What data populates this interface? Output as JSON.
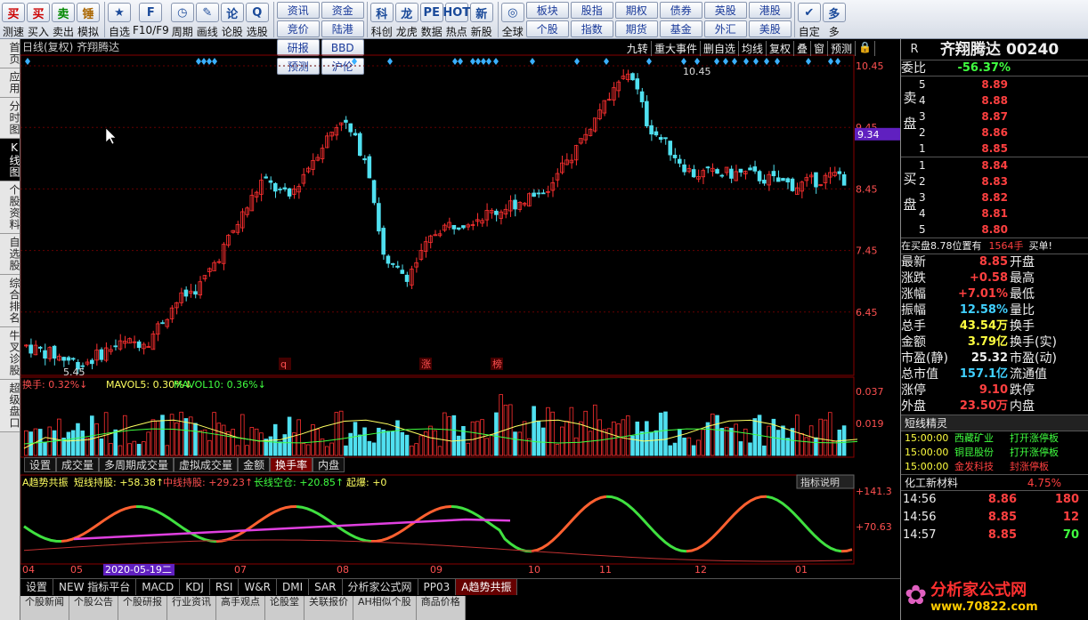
{
  "toolbar": {
    "buttons": [
      {
        "icon": "买",
        "label": "测速",
        "color": "#c00"
      },
      {
        "icon": "买",
        "label": "买入",
        "color": "#c00"
      },
      {
        "icon": "卖",
        "label": "卖出",
        "color": "#080"
      },
      {
        "icon": "锤",
        "label": "模拟",
        "color": "#a60"
      }
    ],
    "buttons2": [
      {
        "icon": "★",
        "label": "自选"
      },
      {
        "icon": "F",
        "label": "F10/F9"
      },
      {
        "icon": "◷",
        "label": "周期"
      },
      {
        "icon": "✎",
        "label": "画线"
      },
      {
        "icon": "论",
        "label": "论股"
      },
      {
        "icon": "Q",
        "label": "选股"
      }
    ],
    "grid1": [
      "资讯",
      "资金",
      "竞价",
      "陆港",
      "研报",
      "BBD",
      "预测",
      "沪伦"
    ],
    "buttons3": [
      {
        "icon": "科",
        "label": "科创"
      },
      {
        "icon": "龙",
        "label": "龙虎"
      },
      {
        "icon": "PE",
        "label": "数据"
      },
      {
        "icon": "HOT",
        "label": "热点"
      },
      {
        "icon": "新",
        "label": "新股"
      }
    ],
    "buttons4": [
      {
        "icon": "◎",
        "label": "全球"
      }
    ],
    "grid2": [
      "板块",
      "股指",
      "期权",
      "债券",
      "英股",
      "港股",
      "个股",
      "指数",
      "期货",
      "基金",
      "外汇",
      "美股"
    ],
    "buttons5": [
      {
        "icon": "✔",
        "label": "自定"
      },
      {
        "icon": "多",
        "label": "多"
      }
    ]
  },
  "leftnav": [
    "首页",
    "应用",
    "分时图",
    "K线图",
    "个股资料",
    "自选股",
    "综合排名",
    "牛叉诊股",
    "超级盘口"
  ],
  "chart": {
    "title": "日线(复权) 齐翔腾达",
    "top_buttons": [
      "九转",
      "重大事件",
      "删自选",
      "均线",
      "复权",
      "叠",
      "窗",
      "预测",
      "🔒"
    ],
    "price_labels": [
      "10.45",
      "9.45",
      "8.45",
      "7.45",
      "6.45"
    ],
    "current_price": "9.34",
    "high_annot": "10.45",
    "low_annot": "5.45",
    "markers": [
      "q",
      "涨",
      "榜"
    ],
    "vol_header": {
      "a": "换手: 0.32%↓",
      "b": "MAVOL5: 0.30%↓",
      "c": "MAVOL10: 0.36%↓"
    },
    "vol_labels": [
      "0.037",
      "0.019"
    ],
    "sub_tabs": [
      "设置",
      "成交量",
      "多周期成交量",
      "虚拟成交量",
      "金额",
      "换手率",
      "内盘"
    ],
    "ind_header": {
      "name": "A趋势共振",
      "a": "短线持股: +58.38↑",
      "b": "中线持股: +29.23↑",
      "c": "长线空仓: +20.85↑",
      "d": "起爆: +0"
    },
    "ind_button": "指标说明",
    "ind_labels": [
      "+141.3",
      "+70.63"
    ],
    "months": [
      "04",
      "05",
      "2020-05-19二",
      "07",
      "08",
      "09",
      "10",
      "11",
      "12",
      "01"
    ],
    "bottom_tabs": [
      "设置",
      "NEW 指标平台",
      "MACD",
      "KDJ",
      "RSI",
      "W&R",
      "DMI",
      "SAR",
      "分析家公式网",
      "PP03",
      "A趋势共振"
    ],
    "news_tabs": [
      "个股新闻",
      "个股公告",
      "个股研报",
      "行业资讯",
      "高手观点",
      "论股堂",
      "关联报价",
      "AH相似个股",
      "商品价格"
    ]
  },
  "quote": {
    "r": "R",
    "name": "齐翔腾达",
    "code": "00240",
    "weibi_label": "委比",
    "weibi": "-56.37%",
    "sell_label": "卖盘",
    "buy_label": "买盘",
    "sell": [
      {
        "n": "5",
        "p": "8.89"
      },
      {
        "n": "4",
        "p": "8.88"
      },
      {
        "n": "3",
        "p": "8.87"
      },
      {
        "n": "2",
        "p": "8.86"
      },
      {
        "n": "1",
        "p": "8.85"
      }
    ],
    "buy": [
      {
        "n": "1",
        "p": "8.84"
      },
      {
        "n": "2",
        "p": "8.83"
      },
      {
        "n": "3",
        "p": "8.82"
      },
      {
        "n": "4",
        "p": "8.81"
      },
      {
        "n": "5",
        "p": "8.80"
      }
    ],
    "tip": "在买盘8.78位置有",
    "tip2": "1564手",
    "tip3": "买单!",
    "stats": [
      {
        "k": "最新",
        "v": "8.85",
        "k2": "开盘"
      },
      {
        "k": "涨跌",
        "v": "+0.58",
        "k2": "最高"
      },
      {
        "k": "涨幅",
        "v": "+7.01%",
        "k2": "最低"
      },
      {
        "k": "振幅",
        "v": "12.58%",
        "k2": "量比"
      },
      {
        "k": "总手",
        "v": "43.54万",
        "k2": "换手"
      },
      {
        "k": "金额",
        "v": "3.79亿",
        "k2": "换手(实)"
      },
      {
        "k": "市盈(静)",
        "v": "25.32",
        "k2": "市盈(动)"
      },
      {
        "k": "总市值",
        "v": "157.1亿",
        "k2": "流通值"
      },
      {
        "k": "涨停",
        "v": "9.10",
        "k2": "跌停"
      },
      {
        "k": "外盘",
        "v": "23.50万",
        "k2": "内盘"
      }
    ],
    "elf_title": "短线精灵",
    "elf": [
      {
        "t": "15:00:00",
        "s": "西藏矿业",
        "e": "打开涨停板"
      },
      {
        "t": "15:00:00",
        "s": "铜昆股份",
        "e": "打开涨停板"
      },
      {
        "t": "15:00:00",
        "s": "金发科技",
        "e": "封涨停板"
      }
    ],
    "sector": "化工新材料",
    "sector_pct": "4.75%",
    "ticks": [
      {
        "t": "14:56",
        "p": "8.86",
        "v": "180"
      },
      {
        "t": "14:56",
        "p": "8.85",
        "v": "12"
      },
      {
        "t": "14:57",
        "p": "8.85",
        "v": "70"
      }
    ],
    "watermark": "分析家公式网",
    "watermark_url": "www.70822.com"
  },
  "chart_data": {
    "type": "candlestick",
    "y_range": [
      5.45,
      10.45
    ],
    "colors": {
      "up": "#ff3030",
      "down": "#50e0f0",
      "bg": "#000"
    }
  }
}
